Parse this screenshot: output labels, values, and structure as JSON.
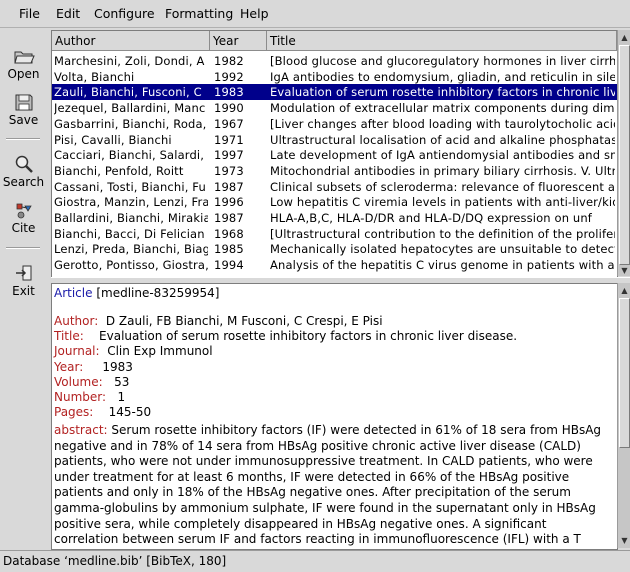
{
  "menu": [
    "File",
    "Edit",
    "Configure",
    "Formatting",
    "Help"
  ],
  "toolbar": {
    "open": "Open",
    "save": "Save",
    "search": "Search",
    "cite": "Cite",
    "exit": "Exit"
  },
  "list": {
    "columns": [
      "Author",
      "Year",
      "Title"
    ],
    "selected_index": 2,
    "rows": [
      {
        "author": "Marchesini, Zoli, Dondi, A",
        "year": "1982",
        "title": "[Blood glucose and glucoregulatory hormones in liver cirrho"
      },
      {
        "author": "Volta, Bianchi",
        "year": "1992",
        "title": "IgA antibodies to endomysium, gliadin, and reticulin in silen"
      },
      {
        "author": "Zauli, Bianchi, Fusconi, C",
        "year": "1983",
        "title": "Evaluation of serum rosette inhibitory factors in chronic live"
      },
      {
        "author": "Jezequel, Ballardini, Manc",
        "year": "1990",
        "title": "Modulation of extracellular matrix components during dimeth"
      },
      {
        "author": "Gasbarrini, Bianchi, Roda,",
        "year": "1967",
        "title": "[Liver changes after blood loading with taurolytocholic acid]"
      },
      {
        "author": "Pisi, Cavalli, Bianchi",
        "year": "1971",
        "title": "Ultrastructural localisation of acid and alkaline phosphatase"
      },
      {
        "author": "Cacciari, Bianchi, Salardi,",
        "year": "1997",
        "title": "Late development of IgA antiendomysial antibodies and sma"
      },
      {
        "author": "Bianchi, Penfold, Roitt",
        "year": "1973",
        "title": "Mitochondrial antibodies in primary biliary cirrhosis. V. Ultra"
      },
      {
        "author": "Cassani, Tosti, Bianchi, Fu",
        "year": "1987",
        "title": "Clinical subsets of scleroderma: relevance of fluorescent an"
      },
      {
        "author": "Giostra, Manzin, Lenzi, Fra",
        "year": "1996",
        "title": "Low hepatitis C viremia levels in patients with anti-liver/kid"
      },
      {
        "author": "Ballardini, Bianchi, Mirakia",
        "year": "1987",
        "title": "HLA-A,B,C, HLA-D/DR and HLA-D/DQ expression on unf"
      },
      {
        "author": "Bianchi, Bacci, Di Felician",
        "year": "1968",
        "title": "[Ultrastructural contribution to the definition of the prolifera"
      },
      {
        "author": "Lenzi, Preda, Bianchi, Biag",
        "year": "1985",
        "title": "Mechanically isolated hepatocytes are unsuitable to detect"
      },
      {
        "author": "Gerotto, Pontisso, Giostra,",
        "year": "1994",
        "title": "Analysis of the hepatitis C virus genome in patients with an"
      }
    ]
  },
  "detail": {
    "type": "Article",
    "key": "[medline-83259954]",
    "fields": [
      {
        "label": "Author:",
        "value": "D Zauli, FB Bianchi, M Fusconi, C Crespi, E Pisi"
      },
      {
        "label": "Title:",
        "value": "Evaluation of serum rosette inhibitory factors in chronic liver disease."
      },
      {
        "label": "Journal:",
        "value": "Clin Exp Immunol"
      },
      {
        "label": "Year:",
        "value": "1983"
      },
      {
        "label": "Volume:",
        "value": "53"
      },
      {
        "label": "Number:",
        "value": "1"
      },
      {
        "label": "Pages:",
        "value": "145-50"
      }
    ],
    "abstract_label": "abstract:",
    "abstract": "Serum rosette inhibitory factors (IF) were detected in 61% of 18 sera from HBsAg negative and in 78% of 14 sera from HBsAg positive chronic active liver disease (CALD) patients, who were not under immunosuppressive treatment. In CALD patients, who were under treatment for at least 6 months, IF were detected in 66% of the HBsAg positive patients and only in 18% of the HBsAg negative ones. After precipitation of the serum gamma-globulins by ammonium sulphate, IF were found in the supernatant only in HBsAg positive sera, while completely disappeared in HBsAg negative ones. A significant correlation between serum IF and factors reacting in immunofluorescence (IFL) with a T enriched preparation of lymphocytes was documented only in HBsAg negative cases. No correlation was found between serum IF and"
  },
  "status": "Database ‘medline.bib’ [BibTeX, 180]",
  "colors": {
    "selection": "#00008b",
    "field_label": "#b22222",
    "entry_type": "#1a1aa8",
    "background": "#d9d9d9"
  },
  "icons": [
    "open-folder-icon",
    "save-disk-icon",
    "search-magnifier-icon",
    "cite-icon",
    "exit-door-icon"
  ]
}
